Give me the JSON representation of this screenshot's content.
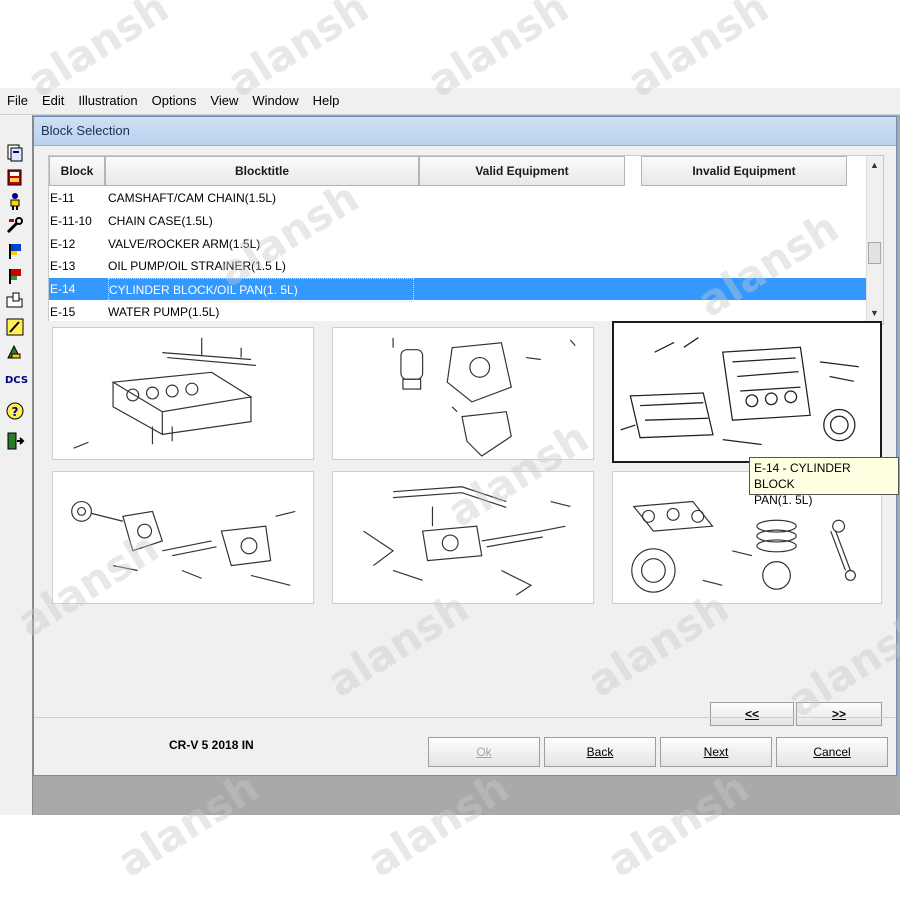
{
  "menubar": {
    "items": [
      "File",
      "Edit",
      "Illustration",
      "Options",
      "View",
      "Window",
      "Help"
    ]
  },
  "toolbar": {
    "icons": [
      "pages-icon",
      "book-icon",
      "person-icon",
      "tools-icon",
      "flag-icon",
      "flag-alt-icon",
      "open-folder-icon",
      "highlight-icon",
      "pen-icon",
      "dcs-icon",
      "help-icon",
      "exit-icon"
    ],
    "dcs_label": "DCS"
  },
  "dialog": {
    "title": "Block Selection",
    "columns": [
      "Block",
      "Blocktitle",
      "Valid Equipment",
      "Invalid Equipment"
    ],
    "rows": [
      {
        "code": "E-11",
        "title": "CAMSHAFT/CAM CHAIN(1.5L)"
      },
      {
        "code": "E-11-10",
        "title": "CHAIN CASE(1.5L)"
      },
      {
        "code": "E-12",
        "title": "VALVE/ROCKER ARM(1.5L)"
      },
      {
        "code": "E-13",
        "title": "OIL PUMP/OIL STRAINER(1.5 L)"
      },
      {
        "code": "E-14",
        "title": "CYLINDER BLOCK/OIL PAN(1. 5L)"
      },
      {
        "code": "E-15",
        "title": "WATER PUMP(1.5L)"
      }
    ],
    "selected_row": 4,
    "tooltip": [
      "E-14 - CYLINDER BLOCK",
      "PAN(1. 5L)"
    ],
    "prev_label": "<<",
    "next_page_label": ">>",
    "model": "CR-V  5  2018  IN",
    "buttons": {
      "ok": "Ok",
      "back": "Back",
      "next": "Next",
      "cancel": "Cancel"
    }
  },
  "watermark": "alansh",
  "colors": {
    "selection": "#3399ff",
    "title_bar": "#bcd3ef",
    "app_bg": "#a9a9a9"
  }
}
